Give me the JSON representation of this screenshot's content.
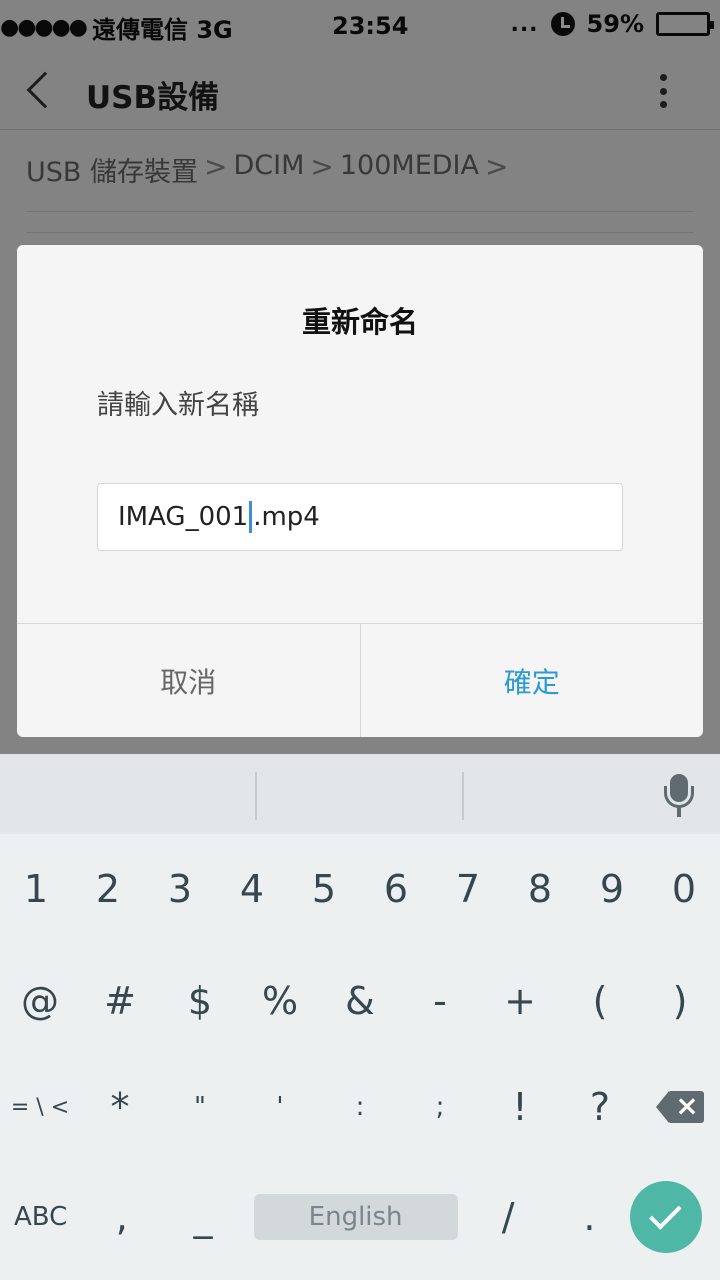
{
  "status_bar": {
    "signal": "●●●●●",
    "carrier": "遠傳電信 3G",
    "time": "23:54",
    "dots": "...",
    "battery_percent": "59%",
    "battery_level": 0.59
  },
  "toolbar": {
    "title": "USB設備"
  },
  "breadcrumb": [
    "USB 儲存裝置",
    "DCIM",
    "100MEDIA"
  ],
  "breadcrumb_separator": ">",
  "dialog": {
    "title": "重新命名",
    "message": "請輸入新名稱",
    "input_before_cursor": "IMAG_001",
    "input_after_cursor": ".mp4",
    "cancel_label": "取消",
    "ok_label": "確定"
  },
  "keyboard": {
    "row1": [
      "1",
      "2",
      "3",
      "4",
      "5",
      "6",
      "7",
      "8",
      "9",
      "0"
    ],
    "row2": [
      "@",
      "#",
      "$",
      "%",
      "&",
      "-",
      "+",
      "(",
      ")"
    ],
    "row3_shift": "= \\ <",
    "row3": [
      "*",
      "\"",
      "'",
      ":",
      ";",
      "!",
      "?"
    ],
    "abc_label": "ABC",
    "comma": ",",
    "underscore": "_",
    "space_label": "English",
    "slash": "/",
    "period": "."
  },
  "colors": {
    "accent": "#2a9bd8",
    "enter": "#4fb7a6"
  }
}
